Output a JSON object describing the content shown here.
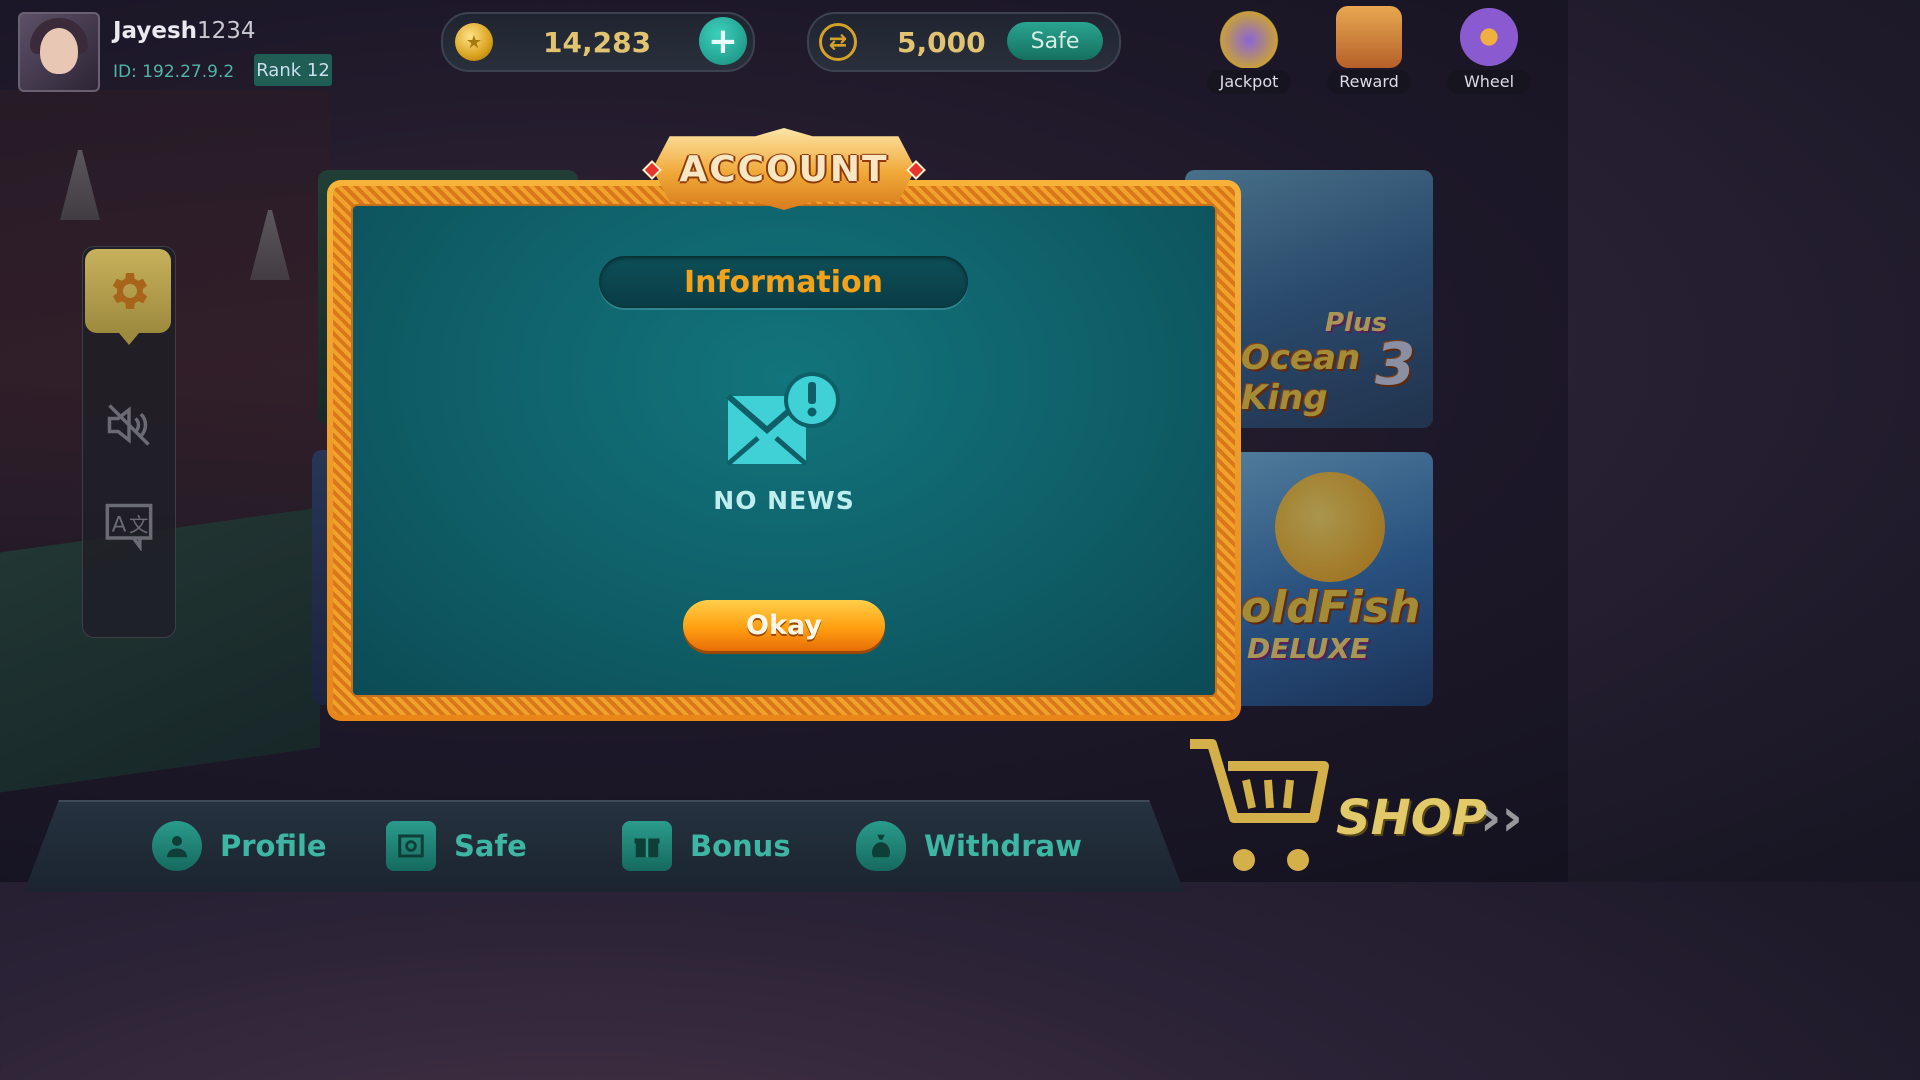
{
  "user": {
    "name": "Jayesh",
    "name_suffix": "1234",
    "id_label": "ID: 192.27.9.2",
    "rank_label": "Rank 12"
  },
  "balance": {
    "coins": "14,283",
    "safe_amount": "5,000",
    "safe_label": "Safe"
  },
  "top_icons": [
    {
      "label": "Jackpot",
      "icon": "jackpot-chest-icon"
    },
    {
      "label": "Reward",
      "icon": "treasure-chest-icon"
    },
    {
      "label": "Wheel",
      "icon": "wheel-icon"
    }
  ],
  "side_panel": {
    "items": [
      {
        "icon": "gear-icon"
      },
      {
        "icon": "mute-icon"
      },
      {
        "icon": "translate-icon"
      }
    ]
  },
  "games": [
    {
      "title": "Ocean King",
      "subtitle": "Plus",
      "number": "3"
    },
    {
      "title": "oldFish",
      "subtitle": "DELUXE"
    }
  ],
  "modal": {
    "banner_title": "ACCOUNT",
    "section_title": "Information",
    "empty_icon": "mail-alert-icon",
    "empty_text": "NO NEWS",
    "okay_label": "Okay"
  },
  "bottom_nav": [
    {
      "label": "Profile",
      "icon": "profile-icon"
    },
    {
      "label": "Safe",
      "icon": "safe-icon"
    },
    {
      "label": "Bonus",
      "icon": "gift-icon"
    },
    {
      "label": "Withdraw",
      "icon": "money-bag-icon"
    }
  ],
  "shop": {
    "label": "SHOP",
    "arrows": "››"
  },
  "colors": {
    "accent_teal": "#1a8a7b",
    "modal_gold": "#f0a22c",
    "modal_bg": "#0f5f68",
    "info_orange": "#f3a21b"
  }
}
